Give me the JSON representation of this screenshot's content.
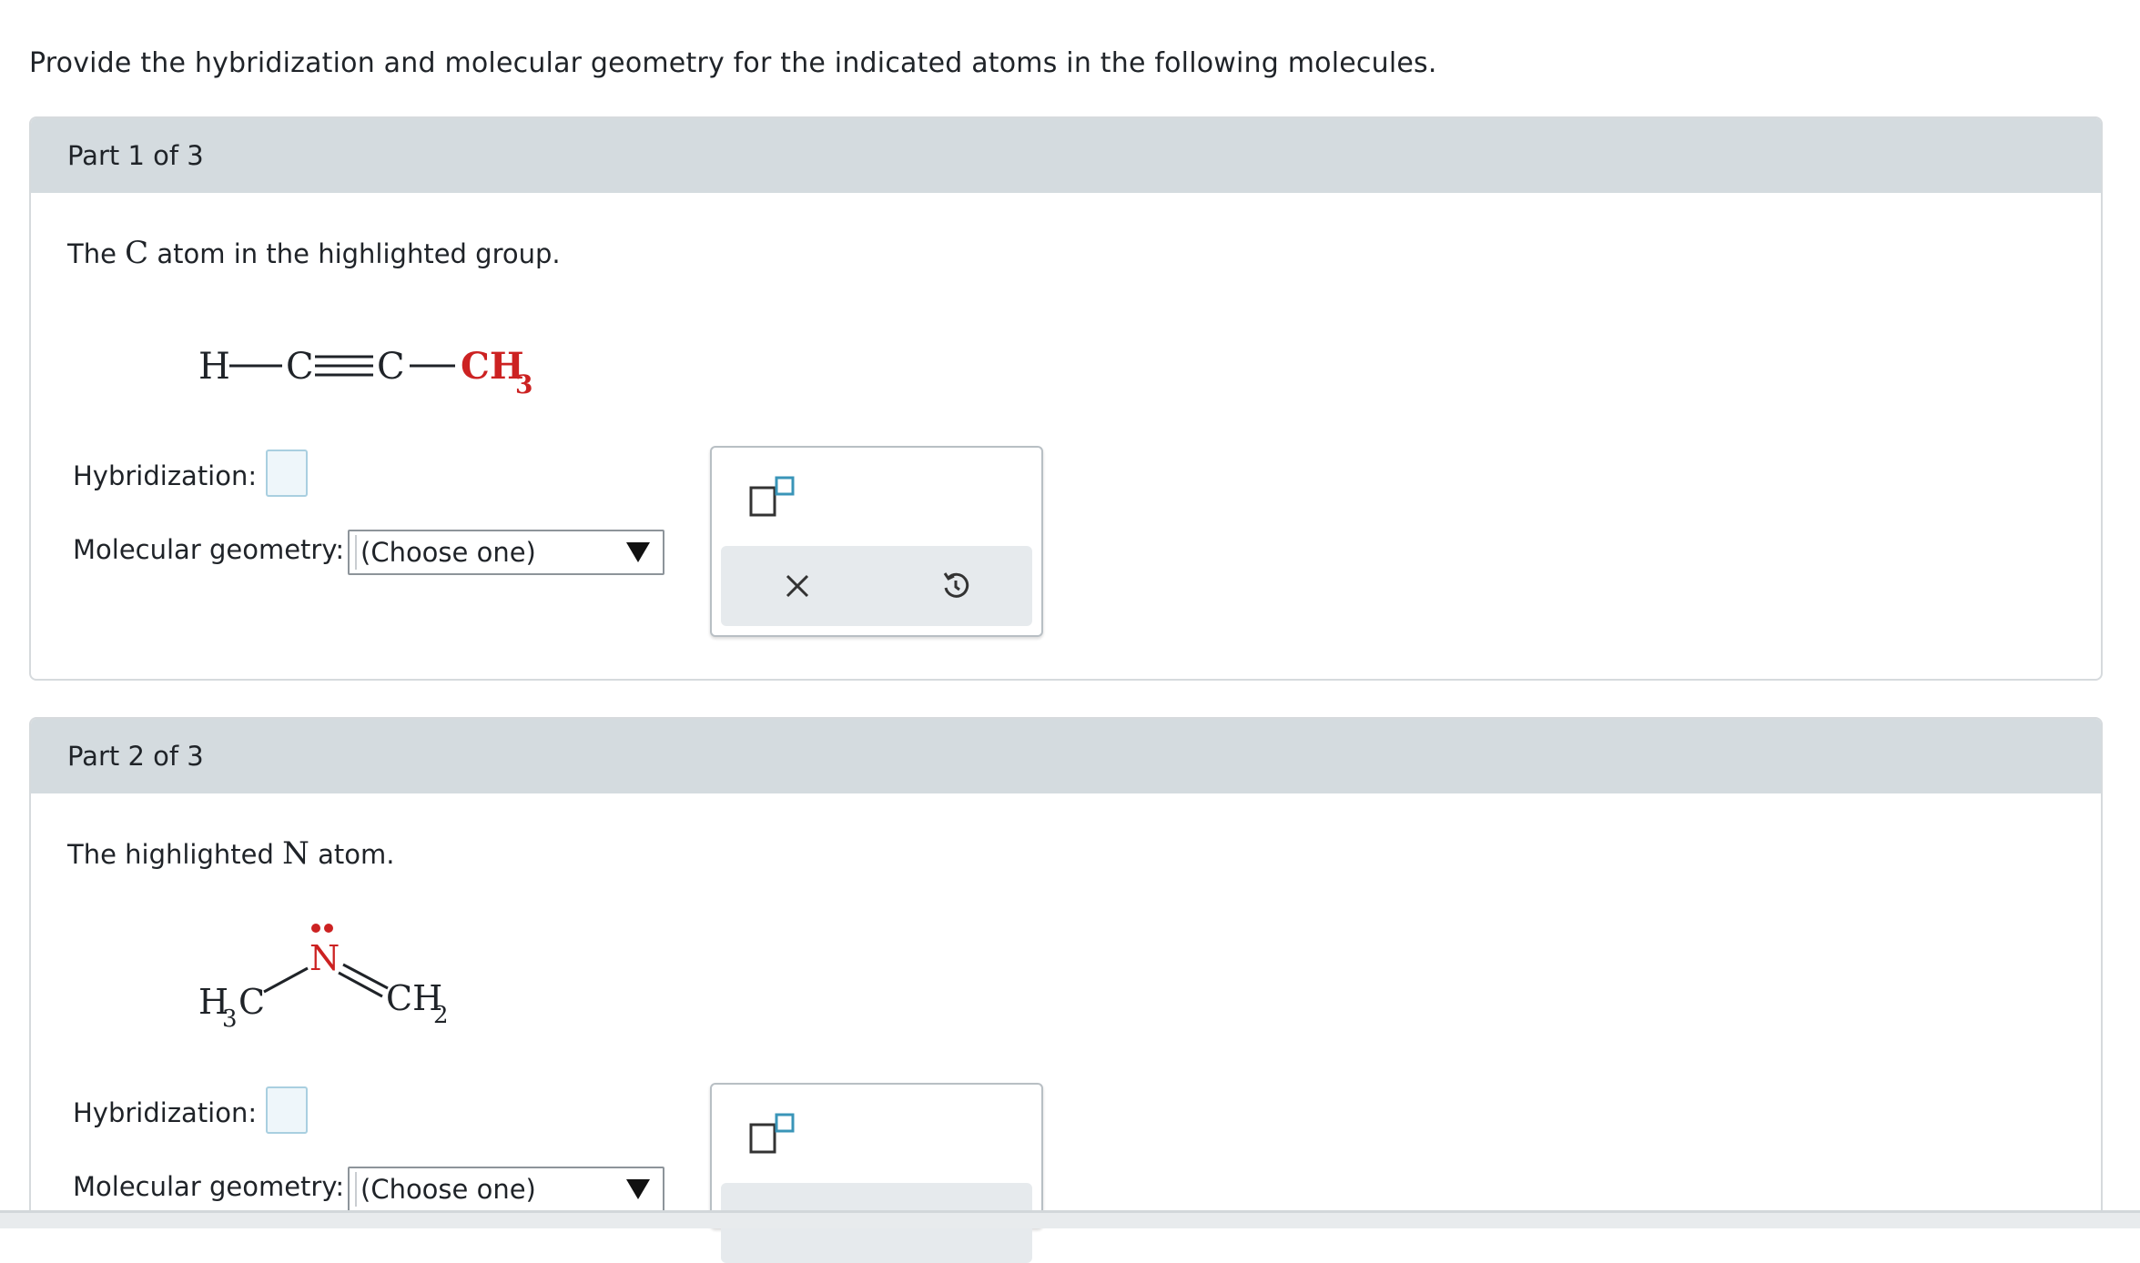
{
  "instruction": "Provide the hybridization and molecular geometry for the indicated atoms in the following molecules.",
  "parts": [
    {
      "header": "Part 1 of 3",
      "prompt_pre": "The ",
      "prompt_atom": "C",
      "prompt_post": " atom in the highlighted group.",
      "molecule": {
        "h": "H",
        "c1": "C",
        "c2": "C",
        "highlight_main": "CH",
        "highlight_sub": "3",
        "highlight_color": "#cc2222"
      },
      "hybridization_label": "Hybridization:",
      "hybridization_value": "",
      "geometry_label": "Molecular geometry:",
      "geometry_selected": "(Choose one)"
    },
    {
      "header": "Part 2 of 3",
      "prompt_pre": "The highlighted ",
      "prompt_atom": "N",
      "prompt_post": " atom.",
      "molecule": {
        "left_main": "H",
        "left_sub": "3",
        "left_c": "C",
        "n": "N",
        "right_main": "CH",
        "right_sub": "2",
        "highlight_color": "#cc2222"
      },
      "hybridization_label": "Hybridization:",
      "hybridization_value": "",
      "geometry_label": "Molecular geometry:",
      "geometry_selected": "(Choose one)"
    }
  ],
  "tool_panel": {
    "superscript_icon": "superscript-box-icon",
    "clear_icon": "close-icon",
    "undo_icon": "undo-icon",
    "accent": "#3a95b8"
  }
}
